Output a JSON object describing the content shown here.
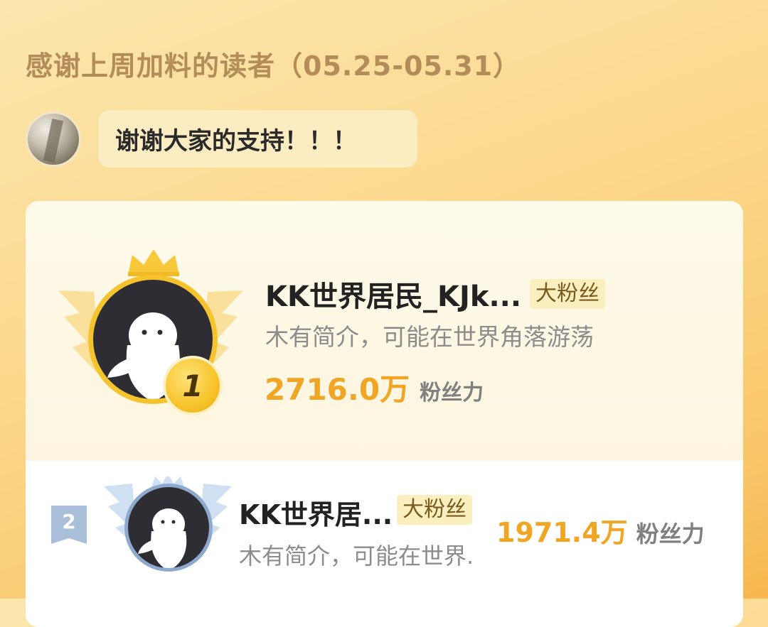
{
  "header": {
    "title": "感谢上周加料的读者（05.25-05.31）"
  },
  "author_message": {
    "text": "谢谢大家的支持！！！"
  },
  "ranking": [
    {
      "rank": "1",
      "name": "KK世界居民_KJk...",
      "badge": "大粉丝",
      "bio": "木有简介，可能在世界角落游荡",
      "fan_power_value": "2716.0万",
      "fan_power_label": "粉丝力"
    },
    {
      "rank": "2",
      "name": "KK世界居...",
      "badge": "大粉丝",
      "bio": "木有简介，可能在世界.",
      "fan_power_value": "1971.4万",
      "fan_power_label": "粉丝力"
    }
  ],
  "colors": {
    "gold": "#f5c32d",
    "fan_power": "#f0a525",
    "silver": "#a9bfd9"
  }
}
